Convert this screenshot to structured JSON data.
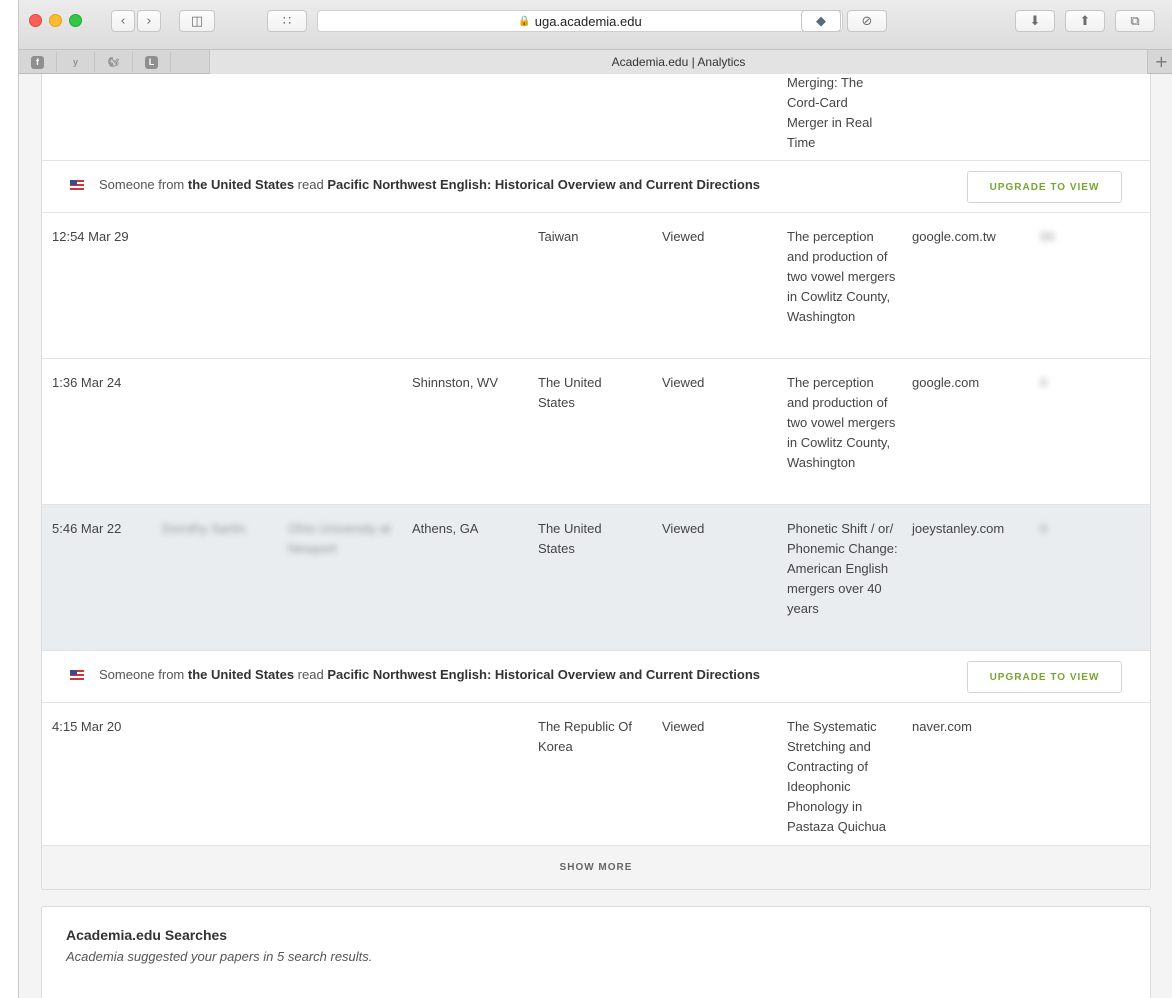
{
  "browser": {
    "url": "uga.academia.edu",
    "tab_title": "Academia.edu | Analytics",
    "lock_icon": "🔒",
    "reload_icon": "↻",
    "back_icon": "‹",
    "forward_icon": "›",
    "sidebar_icon": "◫",
    "grid_icon": "∷",
    "download_icon": "⬇",
    "share_icon": "⬆",
    "tabs_icon": "⧉",
    "newtab_icon": "+",
    "pinned": [
      "f",
      "y",
      "🐿",
      "L"
    ]
  },
  "top_row": {
    "title_lines": [
      "Merging: The",
      "Cord-Card",
      "Merger in Real",
      "Time"
    ]
  },
  "notice": {
    "prefix": "Someone from ",
    "country": "the United States",
    "mid": " read ",
    "paper": "Pacific Northwest English: Historical Overview and Current Directions",
    "button": "UPGRADE TO VIEW"
  },
  "rows": [
    {
      "time": "12:54 Mar 29",
      "location": "",
      "country": "Taiwan",
      "action": "Viewed",
      "title": "The perception and production of two vowel mergers in Cowlitz County, Washington",
      "referrer": "google.com.tw",
      "extra": "00"
    },
    {
      "time": "1:36 Mar 24",
      "location": "Shinnston, WV",
      "country": "The United States",
      "action": "Viewed",
      "title": "The perception and production of two vowel mergers in Cowlitz County, Washington",
      "referrer": "google.com",
      "extra": "0"
    },
    {
      "time": "5:46 Mar 22",
      "name": "Dorothy Sartin",
      "org": "Ohio University at Newport",
      "location": "Athens, GA",
      "country": "The United States",
      "action": "Viewed",
      "title": "Phonetic Shift / or/ Phonemic Change: American English mergers over 40 years",
      "referrer": "joeystanley.com",
      "extra": "0"
    },
    {
      "time": "4:15 Mar 20",
      "location": "",
      "country": "The Republic Of Korea",
      "action": "Viewed",
      "title": "The Systematic Stretching and Contracting of Ideophonic Phonology in Pastaza Quichua",
      "referrer": "naver.com",
      "extra": ""
    }
  ],
  "show_more": "SHOW MORE",
  "searches": {
    "title": "Academia.edu Searches",
    "subtitle": "Academia suggested your papers in 5 search results."
  }
}
